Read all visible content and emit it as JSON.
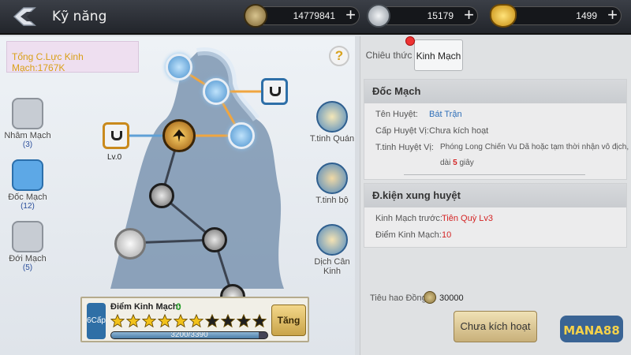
{
  "header": {
    "title": "Kỹ năng",
    "currencies": [
      {
        "icon": "copper-coin-icon",
        "value": "14779841"
      },
      {
        "icon": "silver-coin-icon",
        "value": "15179"
      },
      {
        "icon": "gold-ingot-icon",
        "value": "1499"
      }
    ]
  },
  "left": {
    "total_power": "Tổng C.Lực Kinh Mạch:1767K",
    "help": "?",
    "side_tabs": [
      {
        "label": "Nhâm Mạch",
        "count": "(3)"
      },
      {
        "label": "Đốc Mạch",
        "count": "(12)"
      },
      {
        "label": "Đới Mạch",
        "count": "(5)"
      }
    ],
    "right_items": [
      {
        "label": "T.tinh Quán"
      },
      {
        "label": "T.tinh bộ"
      },
      {
        "label": "Dịch Cân Kinh"
      }
    ],
    "node_level": "Lv.0",
    "bottom": {
      "level_label": "6Cấp",
      "points_label": "Điểm Kinh Mạch:",
      "points_value": "0",
      "stars_filled": 6,
      "stars_total": 10,
      "progress_text": "3200/3390",
      "progress": 0.944,
      "upgrade_label": "Tăng"
    }
  },
  "right": {
    "tabs": [
      {
        "label": "Chiêu thức"
      },
      {
        "label": "Kinh Mạch"
      }
    ],
    "card1": {
      "title": "Đốc Mạch",
      "rows": [
        {
          "label": "Tên Huyệt:",
          "value": "Bát Trận"
        },
        {
          "label": "Cấp Huyệt Vị:",
          "value": "Chưa kích hoạt"
        },
        {
          "label": "T.tinh Huyệt Vị:",
          "value": "Phóng Long Chiến Vu Dã hoặc tạm thời nhận vô địch, kéo"
        },
        {
          "label": "",
          "value": "dài 5 giây"
        }
      ]
    },
    "card2": {
      "title": "Đ.kiện xung huyệt",
      "rows": [
        {
          "label": "Kinh Mạch trước:",
          "value": "Tiên Quỳ Lv3"
        },
        {
          "label": "Điểm Kinh Mạch:",
          "value": "10"
        }
      ]
    },
    "cost_label": "Tiêu hao Đồng:",
    "cost_value": "30000",
    "activate_label": "Chưa kích hoạt"
  },
  "watermark": {
    "text": "MANA88"
  },
  "colors": {
    "accent_blue": "#2f6fb8",
    "warning_red": "#d42424",
    "gold": "#d9a018"
  }
}
